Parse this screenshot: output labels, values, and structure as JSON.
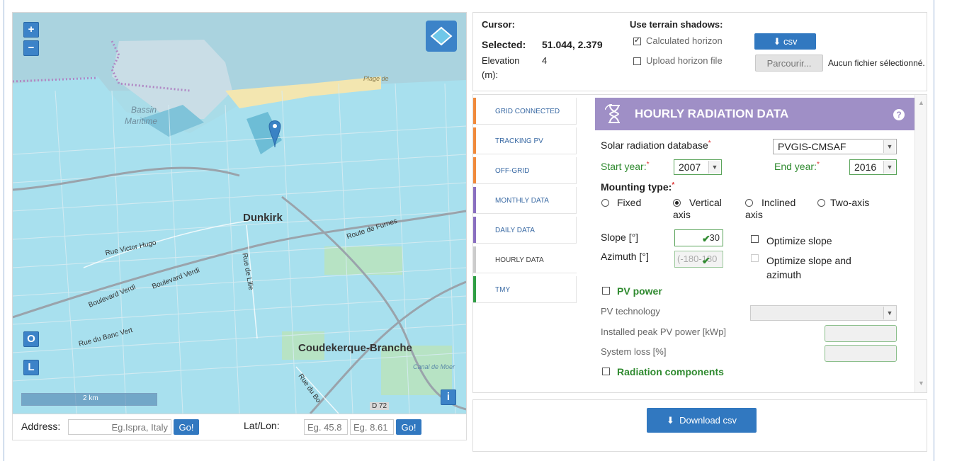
{
  "map": {
    "zoom_in": "+",
    "zoom_out": "−",
    "btn_o": "O",
    "btn_l": "L",
    "btn_i": "i",
    "scale": "2 km",
    "labels": {
      "dunkirk": "Dunkirk",
      "coudekerque": "Coudekerque-Branche",
      "bassin": "Bassin",
      "maritime": "Maritime",
      "plage": "Plage de",
      "route_furnes": "Route de Furnes",
      "rue_hugo": "Rue Victor Hugo",
      "bd_verdi_1": "Boulevard Verdi",
      "bd_verdi_2": "Boulevard Verdi",
      "rue_lille": "Rue de Lille",
      "rue_banc": "Rue du Banc Vert",
      "rue_bo": "Rue du Bo",
      "d72": "D 72",
      "canal": "Canal de Moer"
    }
  },
  "address_bar": {
    "address_label": "Address:",
    "address_placeholder": "Eg.Ispra, Italy",
    "go1": "Go!",
    "latlon_label": "Lat/Lon:",
    "lat_placeholder": "Eg. 45.8",
    "lon_placeholder": "Eg. 8.61",
    "go2": "Go!"
  },
  "top": {
    "cursor_label": "Cursor:",
    "selected_label": "Selected:",
    "selected_value": "51.044, 2.379",
    "elevation_label": "Elevation",
    "elevation_unit": "(m):",
    "elevation_value": "4",
    "terrain_title": "Use terrain shadows:",
    "calc_horizon": "Calculated horizon",
    "upload_horizon": "Upload horizon file",
    "csv_btn": "csv",
    "browse_btn": "Parcourir...",
    "no_file": "Aucun fichier sélectionné."
  },
  "tabs": [
    {
      "label": "GRID CONNECTED",
      "color": "#f08a3c"
    },
    {
      "label": "TRACKING PV",
      "color": "#f08a3c"
    },
    {
      "label": "OFF-GRID",
      "color": "#f08a3c"
    },
    {
      "label": "MONTHLY DATA",
      "color": "#8a6fc0"
    },
    {
      "label": "DAILY DATA",
      "color": "#8a6fc0"
    },
    {
      "label": "HOURLY DATA",
      "color": "#cccccc"
    },
    {
      "label": "TMY",
      "color": "#2f9e44"
    }
  ],
  "form": {
    "title": "HOURLY RADIATION DATA",
    "help": "?",
    "db_label": "Solar radiation database",
    "db_value": "PVGIS-CMSAF",
    "start_label": "Start year:",
    "start_value": "2007",
    "end_label": "End year:",
    "end_value": "2016",
    "mounting_label": "Mounting type:",
    "mount_fixed": "Fixed",
    "mount_vertical_1": "Vertical",
    "mount_vertical_2": "axis",
    "mount_inclined_1": "Inclined",
    "mount_inclined_2": "axis",
    "mount_twoaxis": "Two-axis",
    "slope_label": "Slope [°]",
    "slope_value": "30",
    "opt_slope": "Optimize slope",
    "azimuth_label": "Azimuth [°]",
    "azimuth_value": "(-180-180",
    "opt_slope_az_1": "Optimize slope and",
    "opt_slope_az_2": "azimuth",
    "pv_power": "PV power",
    "pv_tech": "PV technology",
    "peak_power": "Installed peak PV power [kWp]",
    "system_loss": "System loss [%]",
    "rad_components": "Radiation components",
    "required_mark": "*"
  },
  "download": {
    "label": "Download csv"
  }
}
